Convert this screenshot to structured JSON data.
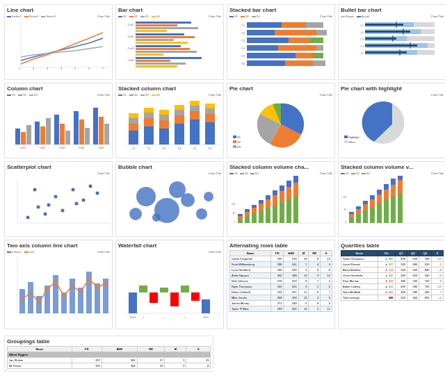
{
  "charts": [
    {
      "id": "line-chart",
      "title": "Line chart",
      "type": "line"
    },
    {
      "id": "bar-chart",
      "title": "Bar chart",
      "type": "bar"
    },
    {
      "id": "stacked-bar-chart",
      "title": "Stacked bar chart",
      "type": "stacked-bar"
    },
    {
      "id": "bullet-bar-chart",
      "title": "Bullet bar chart",
      "type": "bullet"
    },
    {
      "id": "column-chart",
      "title": "Column chart",
      "type": "column"
    },
    {
      "id": "stacked-column-chart",
      "title": "Stacked column chart",
      "type": "stacked-column"
    },
    {
      "id": "pie-chart",
      "title": "Pie chart",
      "type": "pie"
    },
    {
      "id": "pie-highlight-chart",
      "title": "Pie chart with highlight",
      "type": "pie-highlight"
    },
    {
      "id": "scatter-chart",
      "title": "Scatterplot chart",
      "type": "scatter"
    },
    {
      "id": "bubble-chart",
      "title": "Bubble chart",
      "type": "bubble"
    },
    {
      "id": "stacked-vol-chart1",
      "title": "Stacked column volume cha",
      "type": "stacked-vol1"
    },
    {
      "id": "stacked-vol-chart2",
      "title": "Stacked column volume v",
      "type": "stacked-vol2"
    },
    {
      "id": "two-axis-chart",
      "title": "Two axis column line chart",
      "type": "two-axis"
    },
    {
      "id": "waterfall-chart",
      "title": "Waterfall chart",
      "type": "waterfall"
    },
    {
      "id": "alt-table",
      "title": "Alternating rows table",
      "type": "alt-table"
    },
    {
      "id": "quartiles-table",
      "title": "Quartiles table",
      "type": "quartiles-table"
    },
    {
      "id": "groupings-table",
      "title": "Groupings table",
      "type": "groupings-table"
    }
  ],
  "inner_title": "Chart Title",
  "colors": {
    "blue": "#4472C4",
    "orange": "#ED7D31",
    "gray": "#A5A5A5",
    "yellow": "#FFC000",
    "green": "#70AD47",
    "red": "#FF0000",
    "lightblue": "#9DC3E6",
    "darkblue": "#2E5490"
  }
}
